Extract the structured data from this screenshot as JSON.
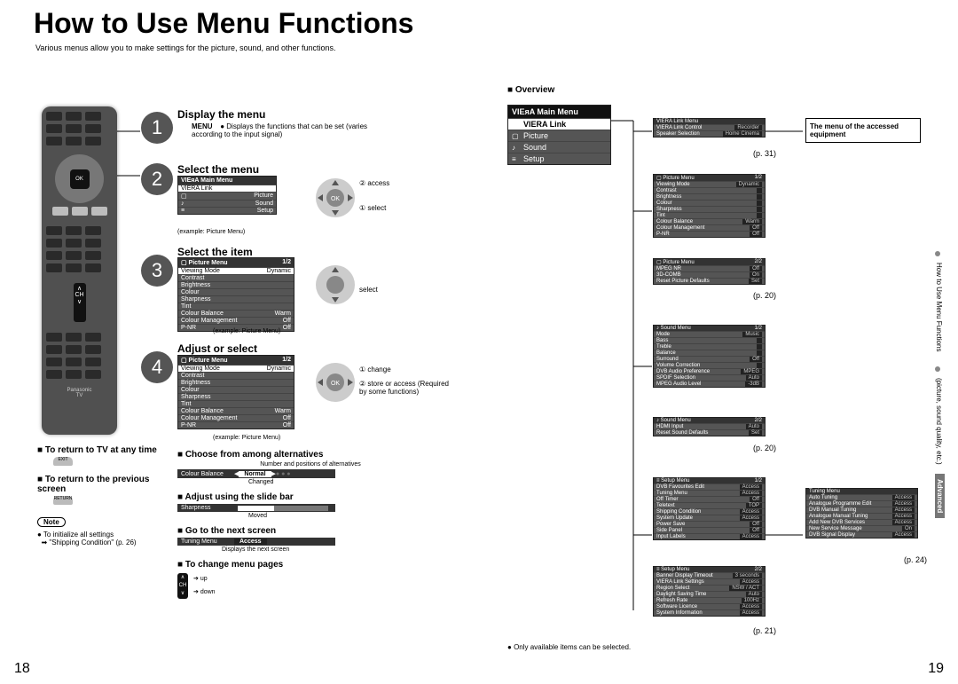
{
  "title": "How to Use Menu Functions",
  "intro": "Various menus allow you to make settings for the picture, sound, and other functions.",
  "page_left": "18",
  "page_right": "19",
  "steps": {
    "s1": {
      "num": "1",
      "label": "Display the menu",
      "menu_btn": "MENU",
      "menu_txt": "Displays the functions that can be set (varies according to the input signal)"
    },
    "s2": {
      "num": "2",
      "label": "Select the menu",
      "a": "② access",
      "b": "① select",
      "caption": "(example: Picture Menu)"
    },
    "s3": {
      "num": "3",
      "label": "Select the item",
      "a": "select",
      "caption": "(example: Picture Menu)"
    },
    "s4": {
      "num": "4",
      "label": "Adjust or select",
      "a": "① change",
      "b": "② store or access (Required by some functions)",
      "caption": "(example: Picture Menu)"
    }
  },
  "mini_main": [
    "VIERA Link",
    "Picture",
    "Sound",
    "Setup"
  ],
  "picture_rows": [
    {
      "n": "Viewing Mode",
      "v": "Dynamic",
      "sel": true
    },
    {
      "n": "Contrast",
      "v": ""
    },
    {
      "n": "Brightness",
      "v": ""
    },
    {
      "n": "Colour",
      "v": ""
    },
    {
      "n": "Sharpness",
      "v": ""
    },
    {
      "n": "Tint",
      "v": ""
    },
    {
      "n": "Colour Balance",
      "v": "Warm"
    },
    {
      "n": "Colour Management",
      "v": "Off"
    },
    {
      "n": "P-NR",
      "v": "Off"
    }
  ],
  "left_notes": {
    "h1": "To return to TV at any time",
    "b1": "EXIT",
    "h2": "To return to the previous screen",
    "b2": "RETURN",
    "note": "Note",
    "note_txt": "To initialize all settings",
    "note_link": "\"Shipping Condition\" (p. 26)"
  },
  "right_steps": {
    "choose": "Choose from among alternatives",
    "choose_caption1": "Number and positions of alternatives",
    "choose_row": {
      "n": "Colour Balance",
      "v": "Normal"
    },
    "choose_caption2": "Changed",
    "adjust": "Adjust using the slide bar",
    "adjust_row": {
      "n": "Sharpness"
    },
    "adjust_caption": "Moved",
    "next": "Go to the next screen",
    "next_row": {
      "n": "Tuning Menu",
      "v": "Access"
    },
    "next_caption": "Displays the next screen",
    "change": "To change menu pages",
    "up": "up",
    "down": "down",
    "ch": "CH"
  },
  "overview": {
    "label": "Overview",
    "main_hd": "VIEᴙA Main Menu",
    "main": [
      {
        "icon": "",
        "label": "VIERA Link",
        "sel": true
      },
      {
        "icon": "▢",
        "label": "Picture"
      },
      {
        "icon": "♪",
        "label": "Sound"
      },
      {
        "icon": "≡",
        "label": "Setup"
      }
    ],
    "equip_box": "The menu of the accessed equipment",
    "p31": "(p. 31)",
    "p20a": "(p. 20)",
    "p20b": "(p. 20)",
    "p21": "(p. 21)",
    "p24": "(p. 24)",
    "viera": {
      "hd": "VIERA Link Menu",
      "rows": [
        {
          "n": "VIERA Link Control",
          "v": "Recorder"
        },
        {
          "n": "Speaker Selection",
          "v": "Home Cinema"
        }
      ]
    },
    "pic1": {
      "hd": "Picture Menu",
      "pg": "1/2",
      "rows": [
        {
          "n": "Viewing Mode",
          "v": "Dynamic"
        },
        {
          "n": "Contrast",
          "v": ""
        },
        {
          "n": "Brightness",
          "v": ""
        },
        {
          "n": "Colour",
          "v": ""
        },
        {
          "n": "Sharpness",
          "v": ""
        },
        {
          "n": "Tint",
          "v": ""
        },
        {
          "n": "Colour Balance",
          "v": "Warm"
        },
        {
          "n": "Colour Management",
          "v": "Off"
        },
        {
          "n": "P-NR",
          "v": "Off"
        }
      ]
    },
    "pic2": {
      "hd": "Picture Menu",
      "pg": "2/2",
      "rows": [
        {
          "n": "MPEG NR",
          "v": "Off"
        },
        {
          "n": "3D-COMB",
          "v": "On"
        },
        {
          "n": "Reset Picture Defaults",
          "v": "Set"
        }
      ]
    },
    "snd1": {
      "hd": "Sound Menu",
      "pg": "1/2",
      "rows": [
        {
          "n": "Mode",
          "v": "Music"
        },
        {
          "n": "Bass",
          "v": ""
        },
        {
          "n": "Treble",
          "v": ""
        },
        {
          "n": "Balance",
          "v": ""
        },
        {
          "n": "Surround",
          "v": "Off"
        },
        {
          "n": "Volume Correction",
          "v": ""
        },
        {
          "n": "DVB Audio Preference",
          "v": "MPEG"
        },
        {
          "n": "SPDIF Selection",
          "v": "Auto"
        },
        {
          "n": "MPEG Audio Level",
          "v": "-3dB"
        }
      ]
    },
    "snd2": {
      "hd": "Sound Menu",
      "pg": "2/2",
      "rows": [
        {
          "n": "HDMI Input",
          "v": "Auto"
        },
        {
          "n": "Reset Sound Defaults",
          "v": "Set"
        }
      ]
    },
    "set1": {
      "hd": "Setup Menu",
      "pg": "1/2",
      "rows": [
        {
          "n": "DVB Favourites Edit",
          "v": "Access"
        },
        {
          "n": "Tuning Menu",
          "v": "Access"
        },
        {
          "n": "Off Timer",
          "v": "Off"
        },
        {
          "n": "Teletext",
          "v": "TOP"
        },
        {
          "n": "Shipping Condition",
          "v": "Access"
        },
        {
          "n": "System Update",
          "v": "Access"
        },
        {
          "n": "Power Save",
          "v": "Off"
        },
        {
          "n": "Side Panel",
          "v": "Off"
        },
        {
          "n": "Input Labels",
          "v": "Access"
        }
      ]
    },
    "set2": {
      "hd": "Setup Menu",
      "pg": "2/2",
      "rows": [
        {
          "n": "Banner Display Timeout",
          "v": "3 seconds"
        },
        {
          "n": "VIERA Link Settings",
          "v": "Access"
        },
        {
          "n": "Region Select",
          "v": "NSW / ACT"
        },
        {
          "n": "Daylight Saving Time",
          "v": "Auto"
        },
        {
          "n": "Refresh Rate",
          "v": "100Hz"
        },
        {
          "n": "Software Licence",
          "v": "Access"
        },
        {
          "n": "System Information",
          "v": "Access"
        }
      ]
    },
    "tuning": {
      "hd": "Tuning Menu",
      "rows": [
        {
          "n": "Auto Tuning",
          "v": "Access"
        },
        {
          "n": "Analogue Programme Edit",
          "v": "Access"
        },
        {
          "n": "DVB Manual Tuning",
          "v": "Access"
        },
        {
          "n": "Analogue Manual Tuning",
          "v": "Access"
        },
        {
          "n": "Add New DVB Services",
          "v": "Access"
        },
        {
          "n": "New Service Message",
          "v": "On"
        },
        {
          "n": "DVB Signal Display",
          "v": "Access"
        }
      ]
    },
    "footnote": "Only available items can be selected."
  },
  "sidetab": {
    "line1": "How to Use Menu Functions",
    "line2": "(picture, sound quality, etc.)",
    "adv": "Advanced"
  }
}
